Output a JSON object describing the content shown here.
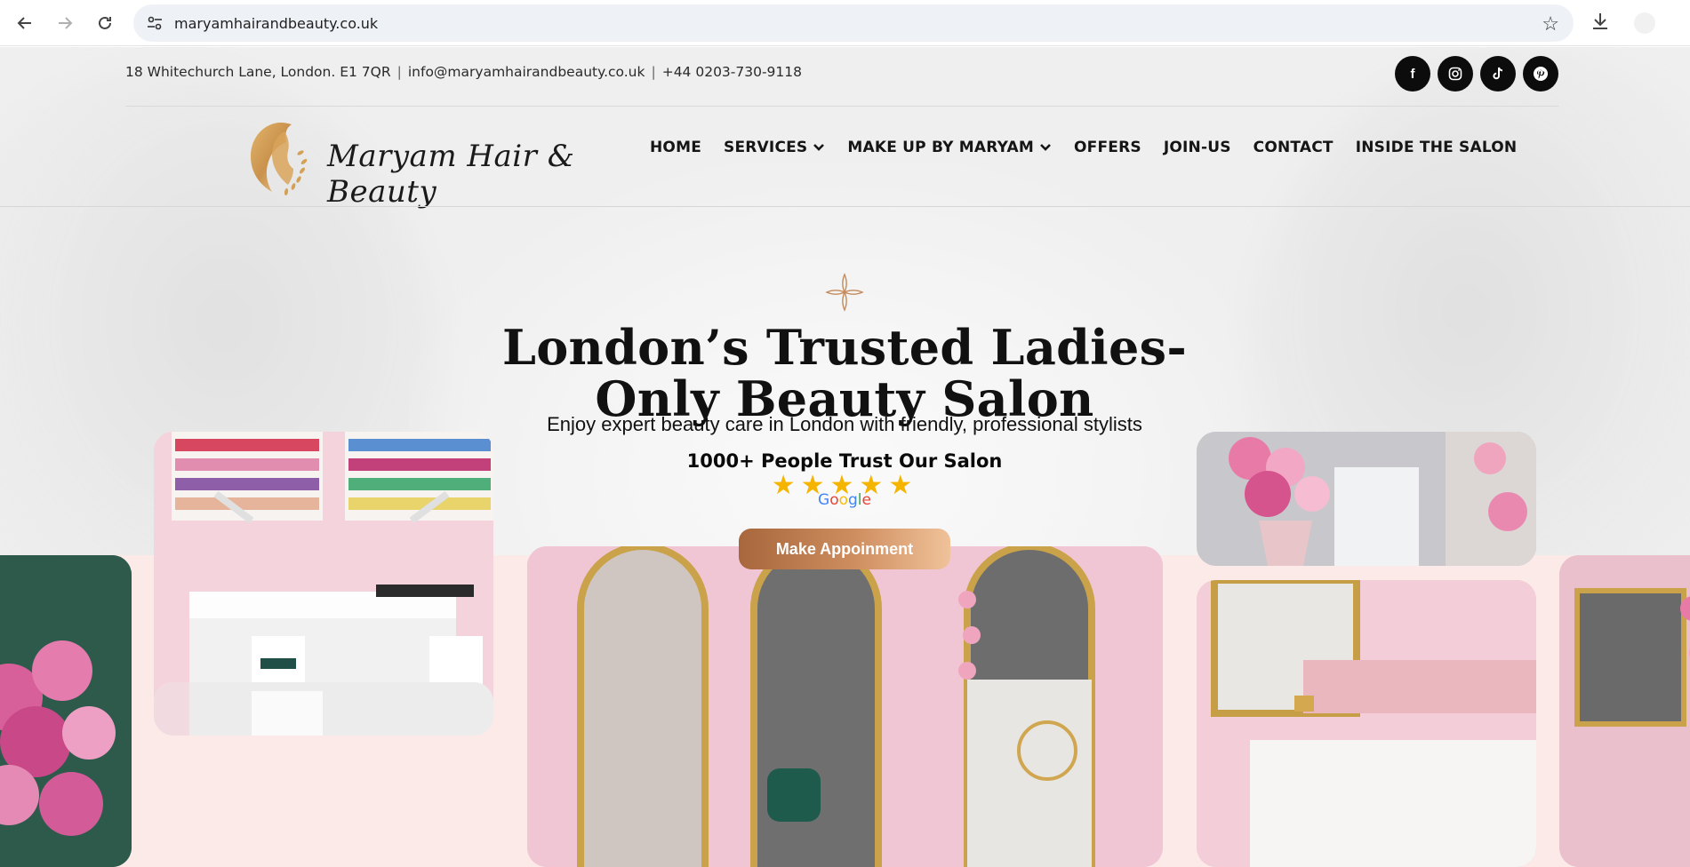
{
  "browser": {
    "url": "maryamhairandbeauty.co.uk"
  },
  "topbar": {
    "address": "18 Whitechurch Lane, London. E1 7QR",
    "email": "info@maryamhairandbeauty.co.uk",
    "phone": "+44 0203-730-9118",
    "separator": "|",
    "socials": [
      {
        "name": "facebook",
        "glyph": "f"
      },
      {
        "name": "instagram",
        "glyph": "◎"
      },
      {
        "name": "tiktok",
        "glyph": "♪"
      },
      {
        "name": "pinterest",
        "glyph": "℗"
      }
    ]
  },
  "logo": {
    "text": "Maryam Hair & Beauty",
    "accent_color": "#c9924d"
  },
  "nav": {
    "items": [
      "HOME",
      "SERVICES",
      "MAKE UP BY MARYAM",
      "OFFERS",
      "JOIN-US",
      "CONTACT",
      "INSIDE THE SALON"
    ]
  },
  "hero": {
    "title_line1": "London’s Trusted Ladies-",
    "title_line2": "Only Beauty Salon",
    "subtitle": "Enjoy expert beauty care in London with friendly, professional stylists",
    "trust": "1000+ People Trust Our Salon",
    "rating_stars": 5,
    "stars_text": "★★★★★",
    "google_letters": [
      "G",
      "o",
      "o",
      "g",
      "l",
      "e"
    ],
    "google_colors": [
      "#4285F4",
      "#EA4335",
      "#FBBC05",
      "#4285F4",
      "#34A853",
      "#EA4335"
    ],
    "cta": "Make Appoinment",
    "cta_colors": [
      "#a8673c",
      "#f0c29a"
    ]
  },
  "gallery": {
    "band_color": "#fbeae8"
  }
}
